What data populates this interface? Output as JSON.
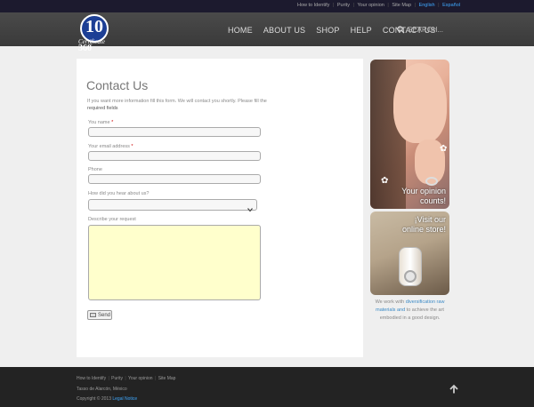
{
  "topbar": {
    "links": [
      "How to Identify",
      "Purity",
      "Your opinion",
      "Site Map"
    ],
    "lang_en": "English",
    "lang_sep": "|",
    "lang_es": "Español"
  },
  "header": {
    "logo_number": "10",
    "logo_text": "Certificate",
    "logo_sub": "360",
    "nav": [
      "HOME",
      "ABOUT US",
      "SHOP",
      "HELP",
      "CONTACT US"
    ],
    "search_placeholder": "SEARCH..."
  },
  "form": {
    "title": "Contact Us",
    "intro": "If you want more information fill this form. We will contact you shortly. Please fill the",
    "intro_required": "required fields",
    "name_label": "You name",
    "email_label": "Your email address",
    "phone_label": "Phone",
    "hear_label": "How did you hear about us?",
    "request_label": "Describe your request",
    "required_mark": "*",
    "send_label": "Send"
  },
  "side": {
    "banner1_caption_1": "Your opinion",
    "banner1_caption_2": "counts!",
    "banner2_caption_1": "¡Visit our",
    "banner2_caption_2": "online store!",
    "text_before": "We work with",
    "text_link": "diversification raw materials and",
    "text_after": "to achieve the art embodied in a good design."
  },
  "footer": {
    "links": [
      "How to Identify",
      "Purity",
      "Your opinion",
      "Site Map"
    ],
    "address": "Tasso de Alarcón, México",
    "copyright": "Copyright © 2013",
    "legal_link": "Legal Notice"
  },
  "colors": {
    "accent": "#3fa9ff",
    "header_bg": "#3f3f3f",
    "footer_bg": "#232323",
    "textarea_bg": "#ffffcc"
  }
}
